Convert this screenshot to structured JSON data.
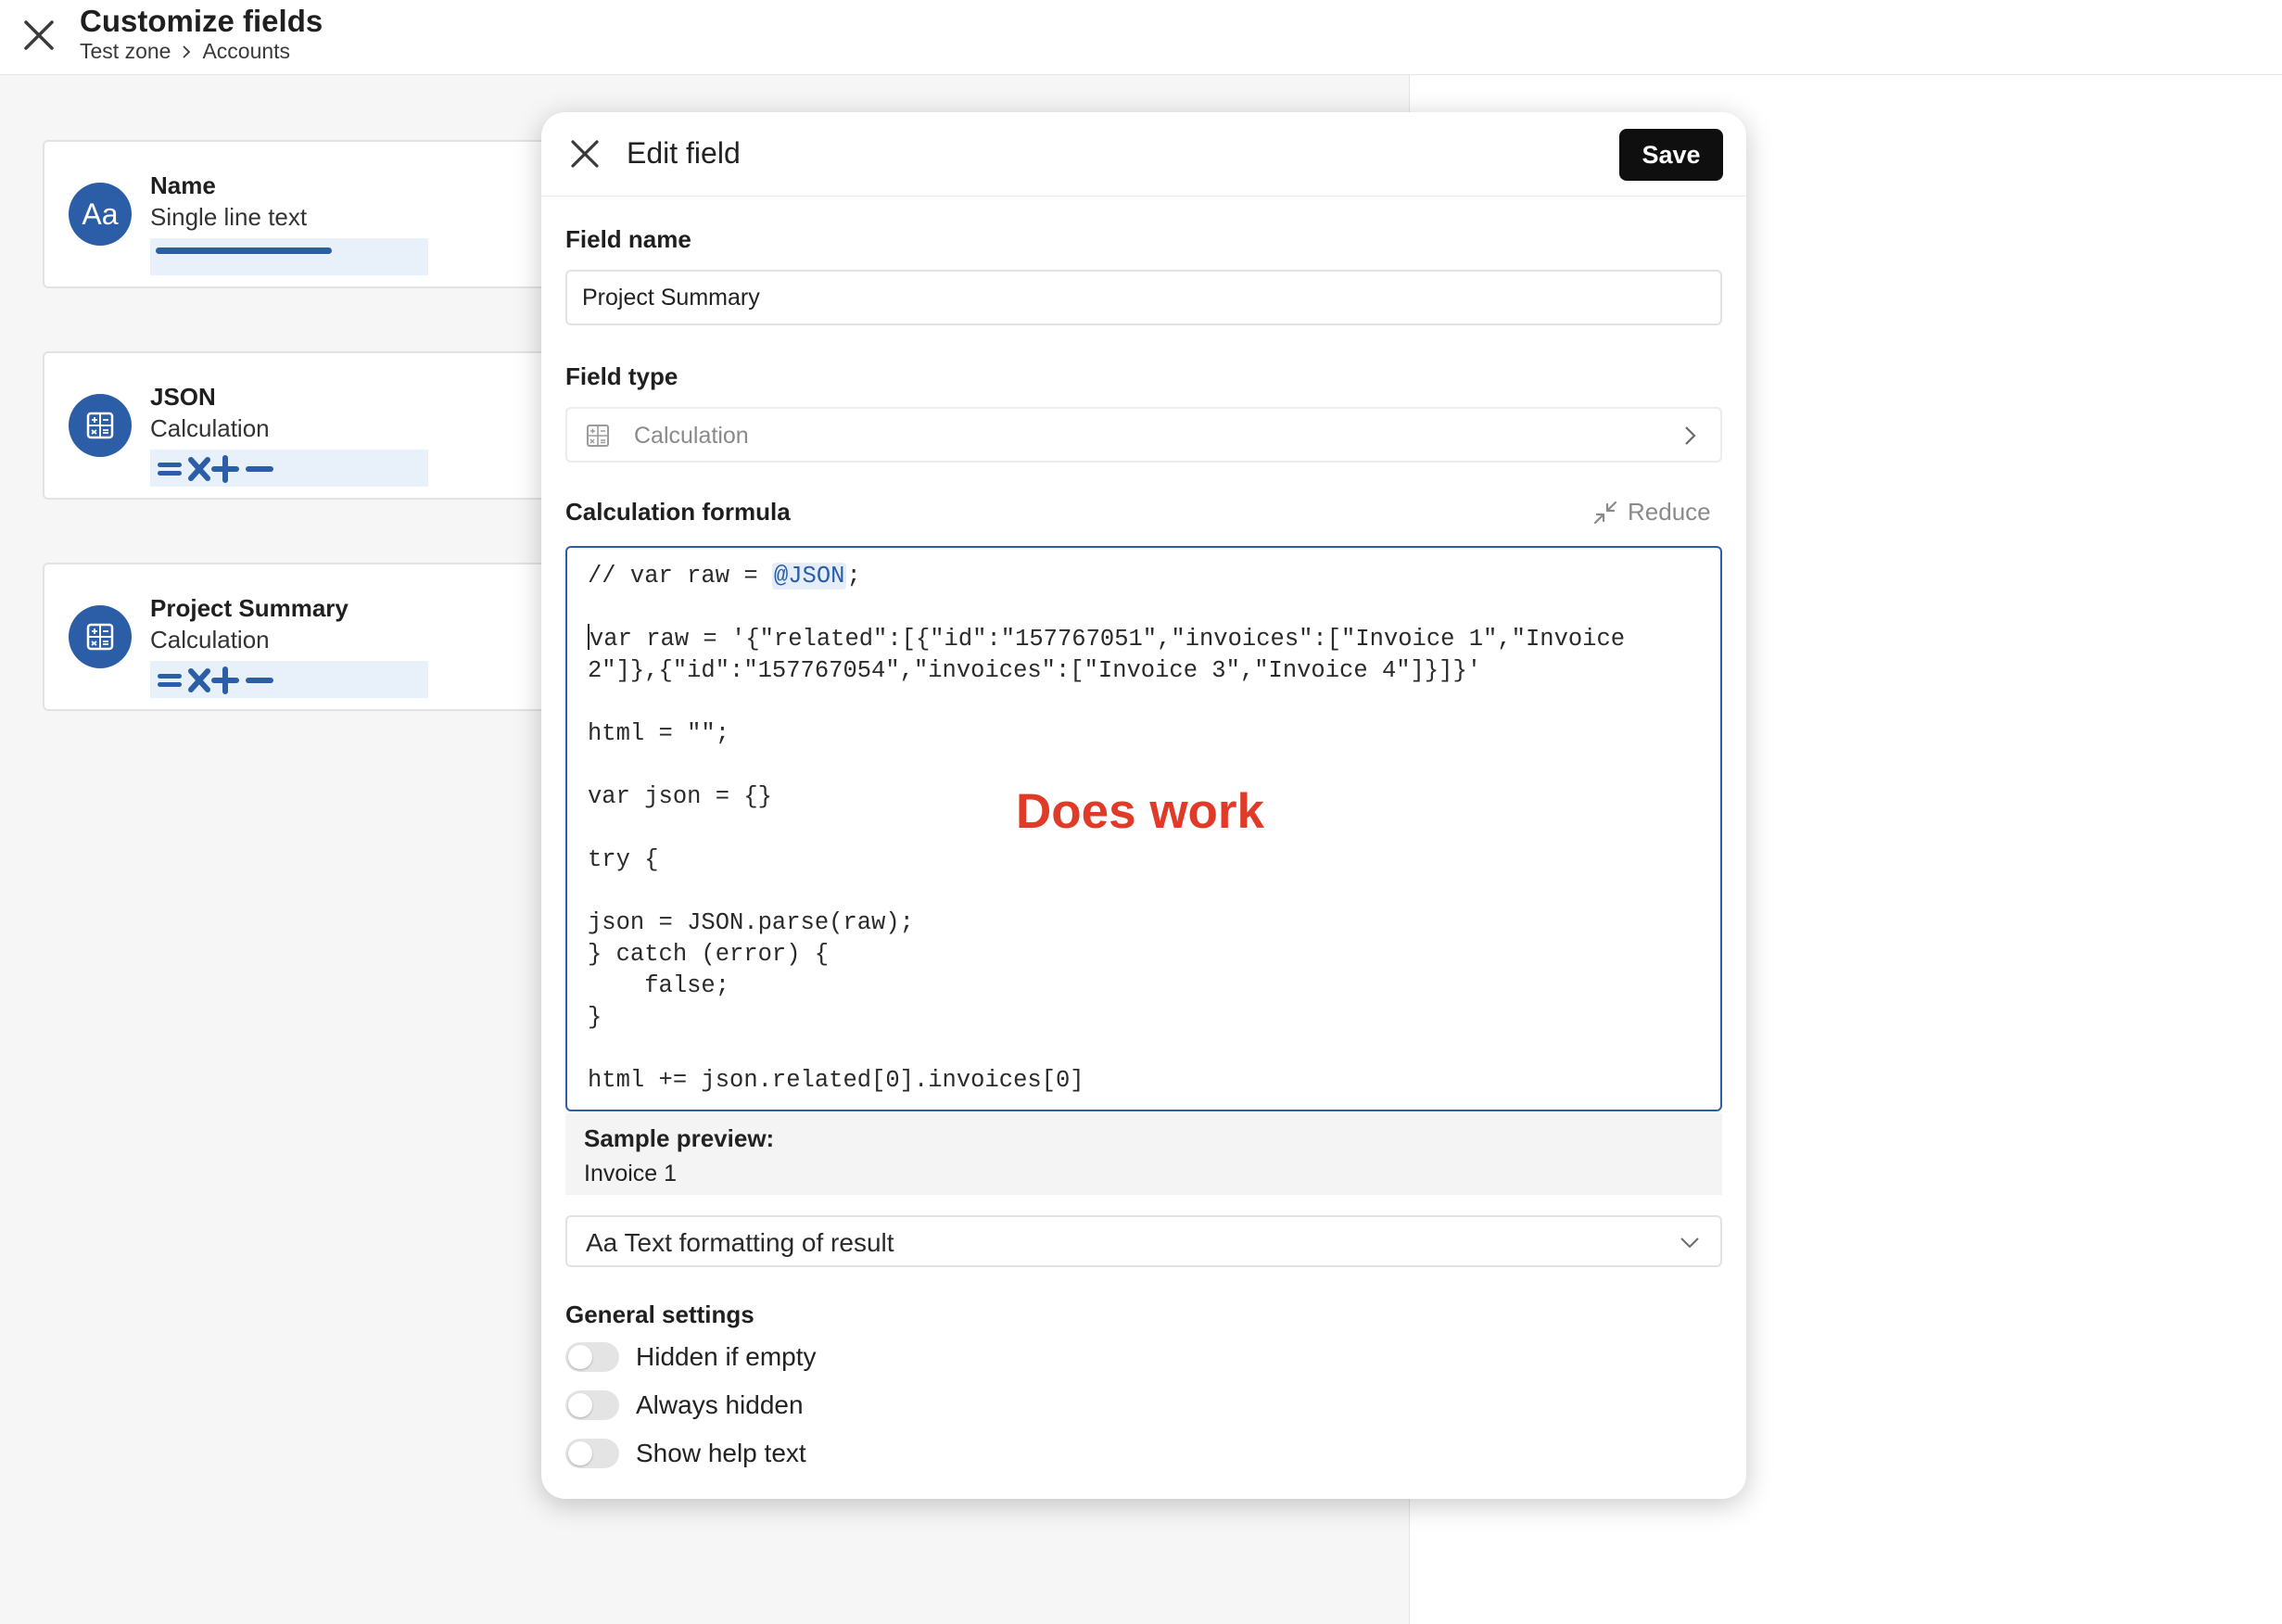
{
  "header": {
    "title": "Customize fields",
    "breadcrumb": [
      "Test zone",
      "Accounts"
    ]
  },
  "fields": [
    {
      "name": "Name",
      "type": "Single line text",
      "avatar_text": "Aa",
      "icon": "text-type-icon"
    },
    {
      "name": "JSON",
      "type": "Calculation",
      "icon": "calculator-icon"
    },
    {
      "name": "Project Summary",
      "type": "Calculation",
      "icon": "calculator-icon"
    }
  ],
  "modal": {
    "title": "Edit field",
    "save_label": "Save",
    "field_name_label": "Field name",
    "field_name_value": "Project Summary",
    "field_type_label": "Field type",
    "field_type_value": "Calculation",
    "formula_label": "Calculation formula",
    "reduce_label": "Reduce",
    "code": {
      "line1_pre": "// var raw = ",
      "line1_token": "@JSON",
      "line1_post": ";",
      "line3": "var raw = '{\"related\":[{\"id\":\"157767051\",\"invoices\":[\"Invoice 1\",\"Invoice",
      "line4": "2\"]},{\"id\":\"157767054\",\"invoices\":[\"Invoice 3\",\"Invoice 4\"]}]}'",
      "line6": "html = \"\";",
      "line8": "var json = {}",
      "line10": "try {",
      "line12": "json = JSON.parse(raw);",
      "line13": "} catch (error) {",
      "line14": "    false;",
      "line15": "}",
      "line17": "html += json.related[0].invoices[0]"
    },
    "annotation": "Does work",
    "preview_label": "Sample preview:",
    "preview_value": "Invoice 1",
    "formatting_label": "Aa Text formatting of result",
    "general_label": "General settings",
    "toggles": [
      "Hidden if empty",
      "Always hidden",
      "Show help text"
    ]
  },
  "colors": {
    "accent": "#2b5ea6",
    "annotation": "#e03a28",
    "save_bg": "#0f0f0f"
  }
}
